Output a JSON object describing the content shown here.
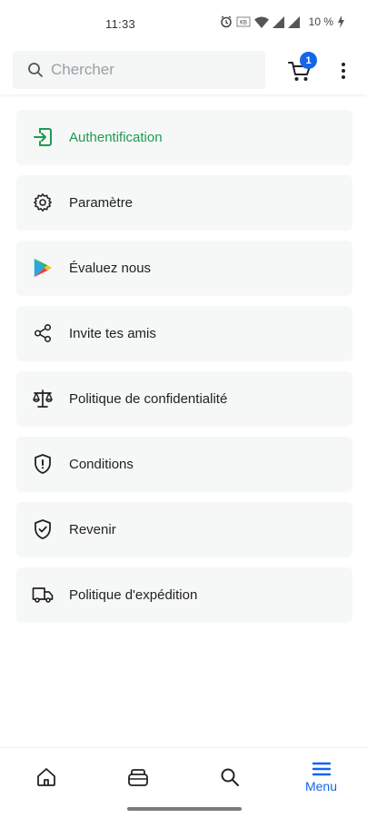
{
  "status_bar": {
    "time": "11:33",
    "battery": "10 %",
    "icons": [
      "alarm-icon",
      "data-speed-icon",
      "wifi-icon",
      "signal-icon",
      "signal-icon",
      "battery-icon"
    ]
  },
  "header": {
    "search_placeholder": "Chercher",
    "cart_badge": "1",
    "icons": [
      "search-icon",
      "cart-icon",
      "more-vertical-icon"
    ]
  },
  "menu": {
    "items": [
      {
        "label": "Authentification",
        "icon": "login-icon",
        "active": true
      },
      {
        "label": "Paramètre",
        "icon": "gear-icon"
      },
      {
        "label": "Évaluez nous",
        "icon": "play-store-icon"
      },
      {
        "label": "Invite tes amis",
        "icon": "share-icon"
      },
      {
        "label": "Politique de confidentialité",
        "icon": "scale-icon"
      },
      {
        "label": "Conditions",
        "icon": "shield-alert-icon"
      },
      {
        "label": "Revenir",
        "icon": "shield-check-icon"
      },
      {
        "label": "Politique d'expédition",
        "icon": "truck-icon"
      }
    ]
  },
  "bottom_nav": {
    "items": [
      {
        "icon": "home-icon"
      },
      {
        "icon": "categories-icon"
      },
      {
        "icon": "search-icon"
      },
      {
        "icon": "menu-icon",
        "label": "Menu",
        "active": true
      }
    ]
  },
  "colors": {
    "accent_green": "#1e9b52",
    "accent_blue": "#1565e8",
    "card_background": "#f6f7f7"
  }
}
